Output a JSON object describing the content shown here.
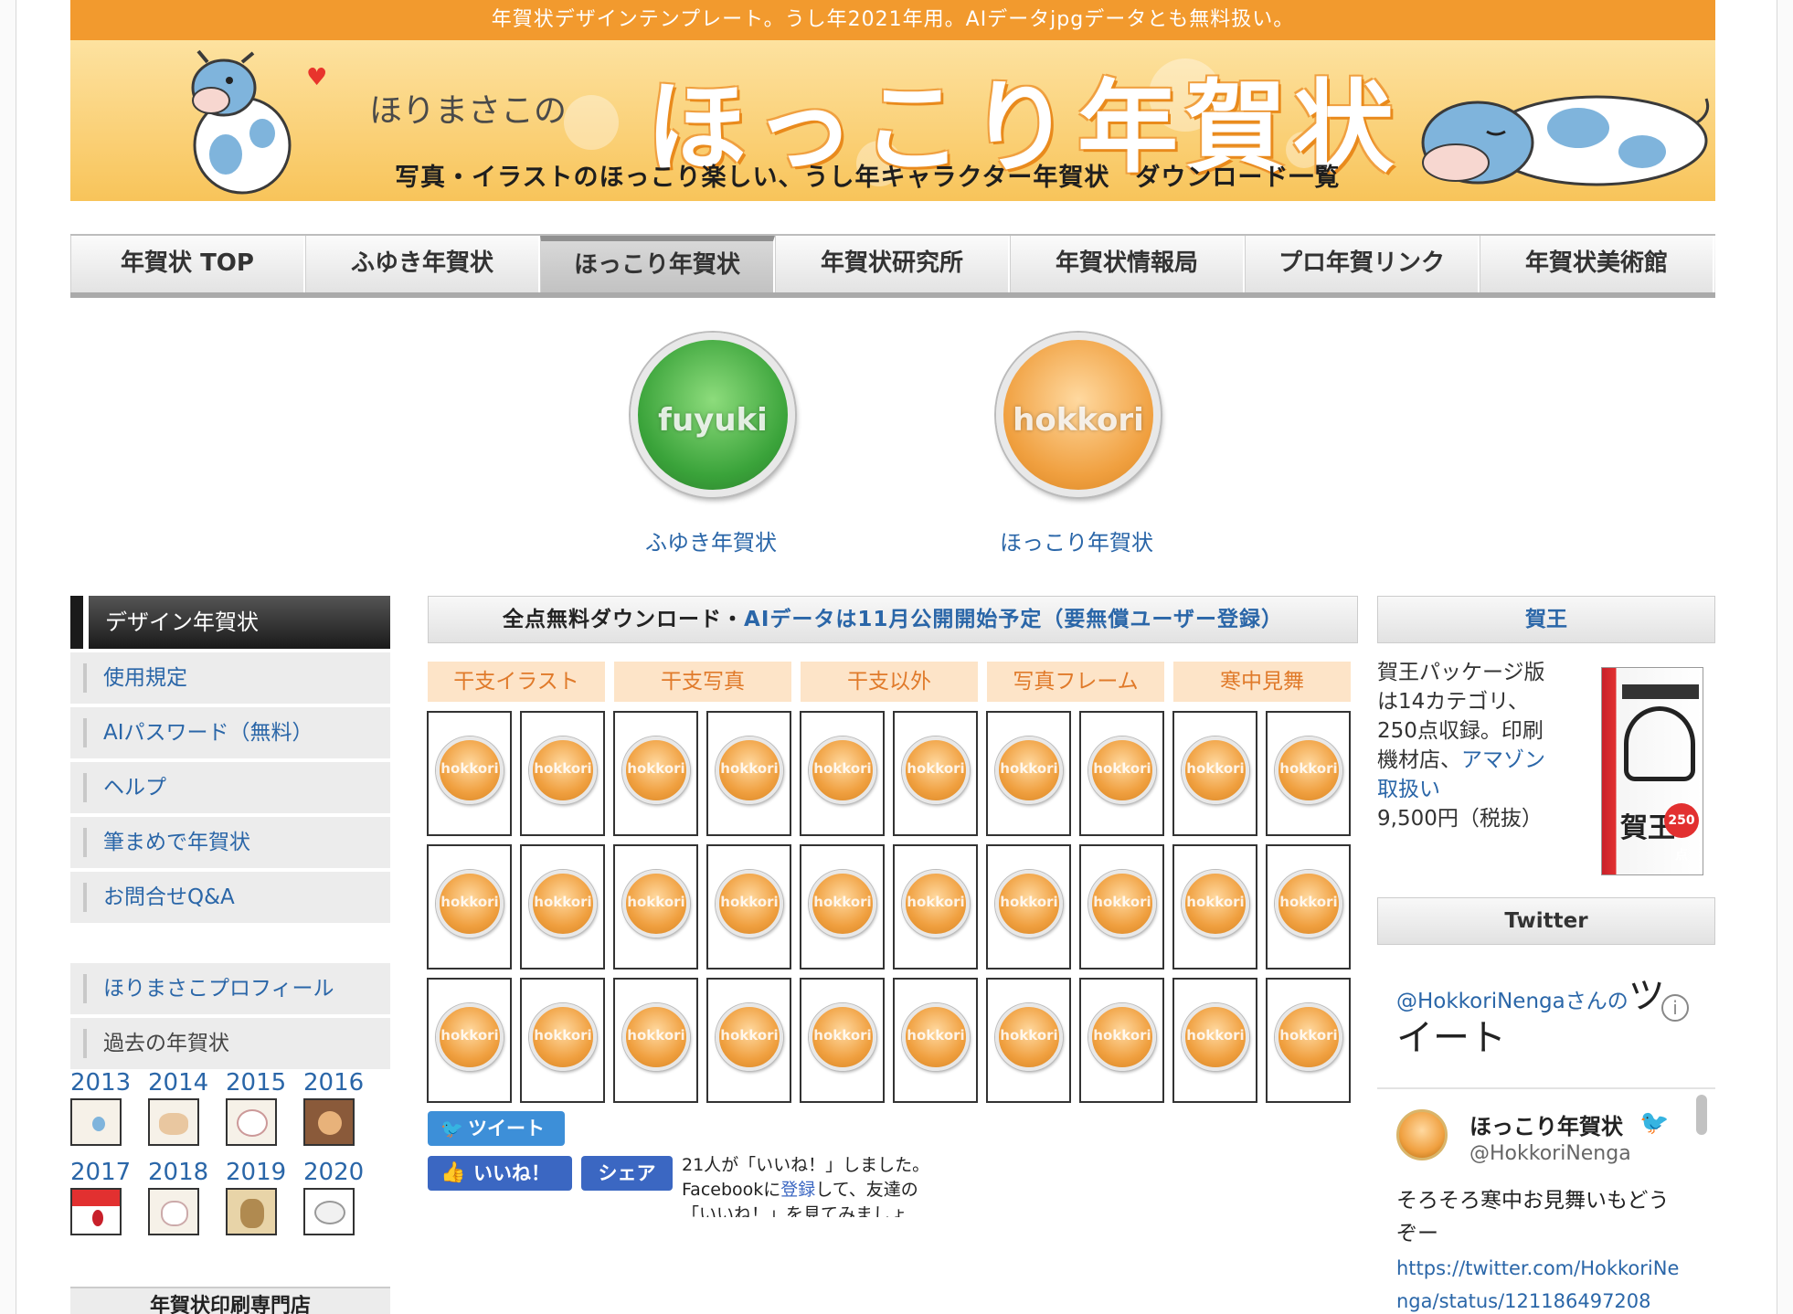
{
  "topbar": {
    "text": "年賀状デザインテンプレート。うし年2021年用。AIデータjpgデータとも無料扱い。"
  },
  "header": {
    "pre_title": "ほりまさこの",
    "title": "ほっこり年賀状",
    "subtitle": "写真・イラストのほっこり楽しい、うし年キャラクター年賀状　ダウンロード一覧"
  },
  "nav": {
    "items": [
      {
        "label": "年賀状 TOP"
      },
      {
        "label": "ふゆき年賀状"
      },
      {
        "label": "ほっこり年賀状"
      },
      {
        "label": "年賀状研究所"
      },
      {
        "label": "年賀状情報局"
      },
      {
        "label": "プロ年賀リンク"
      },
      {
        "label": "年賀状美術館"
      }
    ],
    "active_index": 2
  },
  "badges": {
    "fuyuki": {
      "logo_text": "fuyuki",
      "label": "ふゆき年賀状"
    },
    "hokkori": {
      "logo_text": "hokkori",
      "label": "ほっこり年賀状"
    }
  },
  "sidebar": {
    "heading": "デザイン年賀状",
    "items": [
      {
        "label": "使用規定"
      },
      {
        "label": "AIパスワード（無料）"
      },
      {
        "label": "ヘルプ"
      },
      {
        "label": "筆まめで年賀状"
      },
      {
        "label": "お問合せQ&A"
      }
    ],
    "profile": "ほりまさこプロフィール",
    "past": "過去の年賀状",
    "years_row1": [
      "2013",
      "2014",
      "2015",
      "2016"
    ],
    "years_row2": [
      "2017",
      "2018",
      "2019",
      "2020"
    ],
    "bottom": "年賀状印刷専門店"
  },
  "main": {
    "heading_prefix": "全点無料ダウンロード・",
    "heading_highlight": "AIデータは11月公開開始予定（要無償ユーザー登録）",
    "categories": [
      "干支イラスト",
      "干支写真",
      "干支以外",
      "写真フレーム",
      "寒中見舞"
    ],
    "thumb_text": "hokkori"
  },
  "social": {
    "tweet": "ツイート",
    "like": "いいね！",
    "share": "シェア",
    "fb_count_text": "21人が「いいね！」しました。",
    "fb_facebook": "Facebookに",
    "fb_register": "登録",
    "fb_rest": "して、友達の",
    "fb_line3": "「いいね！」を見てみましょ"
  },
  "right": {
    "gao_heading": "賀王",
    "gao_text1": "賀王パッケージ版は14カテゴリ、250点収録。印刷機材店、",
    "gao_link": "アマゾン取扱い",
    "gao_price": "9,500円（税抜）",
    "pkg_name": "賀王",
    "pkg_count": "250点",
    "twitter_heading": "Twitter",
    "tw_handle_link": "@HokkoriNenga",
    "tw_suffix": "さんの",
    "tw_big1": "ツ",
    "tw_big2": "イート",
    "tw_name": "ほっこり年賀状",
    "tw_handle": "@HokkoriNenga",
    "tw_body": "そろそろ寒中お見舞いもどうぞー",
    "tw_link": "https://twitter.com/HokkoriNenga/status/121186497208"
  },
  "colors": {
    "topbar": "#f29a2e",
    "link": "#2a66a8",
    "category_bg": "#fde4c8",
    "category_text": "#e07a2a",
    "facebook": "#3b67c2",
    "twitter": "#3d8fd8"
  }
}
